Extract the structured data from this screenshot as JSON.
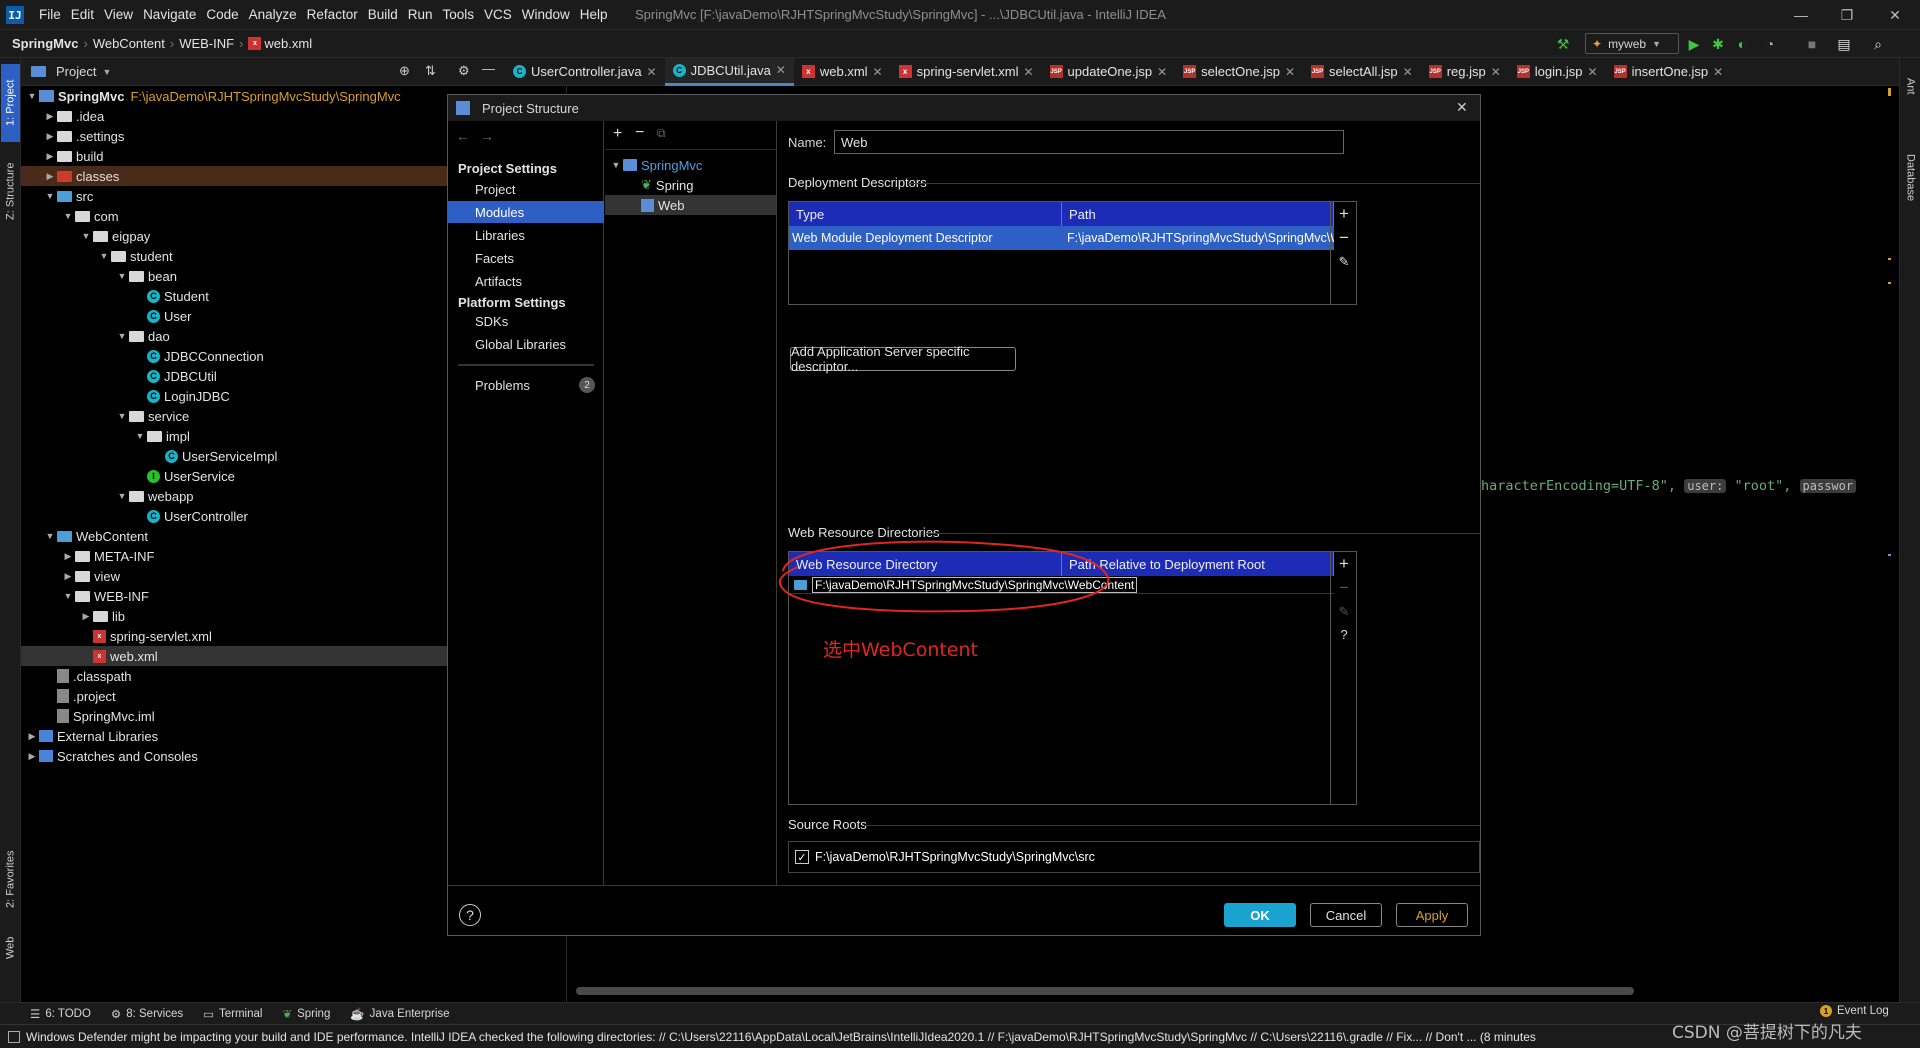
{
  "window": {
    "logo": "IJ",
    "title": "SpringMvc [F:\\javaDemo\\RJHTSpringMvcStudy\\SpringMvc] - ...\\JDBCUtil.java - IntelliJ IDEA",
    "menu": [
      "File",
      "Edit",
      "View",
      "Navigate",
      "Code",
      "Analyze",
      "Refactor",
      "Build",
      "Run",
      "Tools",
      "VCS",
      "Window",
      "Help"
    ],
    "controls": {
      "minimize": "—",
      "restore": "❐",
      "close": "✕"
    }
  },
  "navbar": {
    "breadcrumbs": [
      "SpringMvc",
      "WebContent",
      "WEB-INF",
      "web.xml"
    ],
    "run_config": "myweb"
  },
  "left_stripe": [
    "1: Project",
    "Z: Structure",
    "2: Favorites",
    "Web"
  ],
  "right_stripe": [
    "Ant",
    "Database"
  ],
  "project_panel": {
    "title": "Project",
    "tree": [
      {
        "label": "SpringMvc",
        "path": "F:\\javaDemo\\RJHTSpringMvcStudy\\SpringMvc",
        "depth": 0,
        "arrow": "▼",
        "icon": "mod"
      },
      {
        "label": ".idea",
        "depth": 1,
        "arrow": "▶",
        "icon": "folder"
      },
      {
        "label": ".settings",
        "depth": 1,
        "arrow": "▶",
        "icon": "folder"
      },
      {
        "label": "build",
        "depth": 1,
        "arrow": "▶",
        "icon": "folder"
      },
      {
        "label": "classes",
        "depth": 1,
        "arrow": "▶",
        "icon": "folder-red",
        "highlight": true
      },
      {
        "label": "src",
        "depth": 1,
        "arrow": "▼",
        "icon": "folder-blue"
      },
      {
        "label": "com",
        "depth": 2,
        "arrow": "▼",
        "icon": "folder"
      },
      {
        "label": "eigpay",
        "depth": 3,
        "arrow": "▼",
        "icon": "folder"
      },
      {
        "label": "student",
        "depth": 4,
        "arrow": "▼",
        "icon": "folder"
      },
      {
        "label": "bean",
        "depth": 5,
        "arrow": "▼",
        "icon": "folder"
      },
      {
        "label": "Student",
        "depth": 6,
        "arrow": "",
        "icon": "cls"
      },
      {
        "label": "User",
        "depth": 6,
        "arrow": "",
        "icon": "cls"
      },
      {
        "label": "dao",
        "depth": 5,
        "arrow": "▼",
        "icon": "folder"
      },
      {
        "label": "JDBCConnection",
        "depth": 6,
        "arrow": "",
        "icon": "cls"
      },
      {
        "label": "JDBCUtil",
        "depth": 6,
        "arrow": "",
        "icon": "cls"
      },
      {
        "label": "LoginJDBC",
        "depth": 6,
        "arrow": "",
        "icon": "cls"
      },
      {
        "label": "service",
        "depth": 5,
        "arrow": "▼",
        "icon": "folder"
      },
      {
        "label": "impl",
        "depth": 6,
        "arrow": "▼",
        "icon": "folder"
      },
      {
        "label": "UserServiceImpl",
        "depth": 7,
        "arrow": "",
        "icon": "cls"
      },
      {
        "label": "UserService",
        "depth": 6,
        "arrow": "",
        "icon": "intf"
      },
      {
        "label": "webapp",
        "depth": 5,
        "arrow": "▼",
        "icon": "folder"
      },
      {
        "label": "UserController",
        "depth": 6,
        "arrow": "",
        "icon": "cls"
      },
      {
        "label": "WebContent",
        "depth": 1,
        "arrow": "▼",
        "icon": "folder-blue"
      },
      {
        "label": "META-INF",
        "depth": 2,
        "arrow": "▶",
        "icon": "folder"
      },
      {
        "label": "view",
        "depth": 2,
        "arrow": "▶",
        "icon": "folder"
      },
      {
        "label": "WEB-INF",
        "depth": 2,
        "arrow": "▼",
        "icon": "folder"
      },
      {
        "label": "lib",
        "depth": 3,
        "arrow": "▶",
        "icon": "folder"
      },
      {
        "label": "spring-servlet.xml",
        "depth": 3,
        "arrow": "",
        "icon": "xml"
      },
      {
        "label": "web.xml",
        "depth": 3,
        "arrow": "",
        "icon": "xml",
        "selected": true
      },
      {
        "label": ".classpath",
        "depth": 1,
        "arrow": "",
        "icon": "file"
      },
      {
        "label": ".project",
        "depth": 1,
        "arrow": "",
        "icon": "file"
      },
      {
        "label": "SpringMvc.iml",
        "depth": 1,
        "arrow": "",
        "icon": "file"
      },
      {
        "label": "External Libraries",
        "depth": 0,
        "arrow": "▶",
        "icon": "lib"
      },
      {
        "label": "Scratches and Consoles",
        "depth": 0,
        "arrow": "▶",
        "icon": "lib"
      }
    ]
  },
  "editor_tabs": [
    {
      "label": "UserController.java",
      "icon": "C",
      "type": "cls"
    },
    {
      "label": "JDBCUtil.java",
      "icon": "C",
      "type": "cls",
      "active": true
    },
    {
      "label": "web.xml",
      "icon": "x",
      "type": "x2"
    },
    {
      "label": "spring-servlet.xml",
      "icon": "x",
      "type": "x2"
    },
    {
      "label": "updateOne.jsp",
      "icon": "JSP",
      "type": "j"
    },
    {
      "label": "selectOne.jsp",
      "icon": "JSP",
      "type": "j"
    },
    {
      "label": "selectAll.jsp",
      "icon": "JSP",
      "type": "j"
    },
    {
      "label": "reg.jsp",
      "icon": "JSP",
      "type": "j"
    },
    {
      "label": "login.jsp",
      "icon": "JSP",
      "type": "j"
    },
    {
      "label": "insertOne.jsp",
      "icon": "JSP",
      "type": "j"
    }
  ],
  "editor_code": {
    "text1": "haracterEncoding=UTF-8\",",
    "hint1": "user:",
    "text2": "\"root\",",
    "hint2": "passwor"
  },
  "dialog": {
    "title": "Project Structure",
    "project_settings_heading": "Project Settings",
    "project_settings": [
      "Project",
      "Modules",
      "Libraries",
      "Facets",
      "Artifacts"
    ],
    "platform_settings_heading": "Platform Settings",
    "platform_settings": [
      "SDKs",
      "Global Libraries"
    ],
    "problems_label": "Problems",
    "problems_count": "2",
    "modules_tree": [
      {
        "label": "SpringMvc",
        "depth": 0
      },
      {
        "label": "Spring",
        "depth": 1
      },
      {
        "label": "Web",
        "depth": 1,
        "selected": true
      }
    ],
    "name_label": "Name:",
    "name_value": "Web",
    "deployment_descriptors": {
      "title": "Deployment Descriptors",
      "headers": [
        "Type",
        "Path"
      ],
      "rows": [
        [
          "Web Module Deployment Descriptor",
          "F:\\javaDemo\\RJHTSpringMvcStudy\\SpringMvc\\WebCont"
        ]
      ]
    },
    "add_server_descriptor_button": "Add Application Server specific descriptor...",
    "web_resource_directories": {
      "title": "Web Resource Directories",
      "headers": [
        "Web Resource Directory",
        "Path Relative to Deployment Root"
      ],
      "rows": [
        [
          "F:\\javaDemo\\RJHTSpringMvcStudy\\SpringMvc\\WebContent",
          ""
        ]
      ]
    },
    "annotation": "选中WebContent",
    "source_roots": {
      "title": "Source Roots",
      "items": [
        {
          "path": "F:\\javaDemo\\RJHTSpringMvcStudy\\SpringMvc\\src",
          "checked": true
        }
      ]
    },
    "buttons": {
      "ok": "OK",
      "cancel": "Cancel",
      "apply": "Apply"
    },
    "help": "?"
  },
  "bottom_tools": [
    {
      "label": "6: TODO"
    },
    {
      "label": "8: Services"
    },
    {
      "label": "Terminal"
    },
    {
      "label": "Spring"
    },
    {
      "label": "Java Enterprise"
    }
  ],
  "event_log": "Event Log",
  "status_message": "Windows Defender might be impacting your build and IDE performance. IntelliJ IDEA checked the following directories: // C:\\Users\\22116\\AppData\\Local\\JetBrains\\IntelliJIdea2020.1 // F:\\javaDemo\\RJHTSpringMvcStudy\\SpringMvc // C:\\Users\\22116\\.gradle // Fix... // Don't ... (8 minutes",
  "watermark": "CSDN @菩提树下的凡夫",
  "colors": {
    "accent": "#2d5fc4",
    "table_header": "#1d2cb6",
    "annotation_red": "#e0261e",
    "ok_button": "#1aa3cf"
  }
}
